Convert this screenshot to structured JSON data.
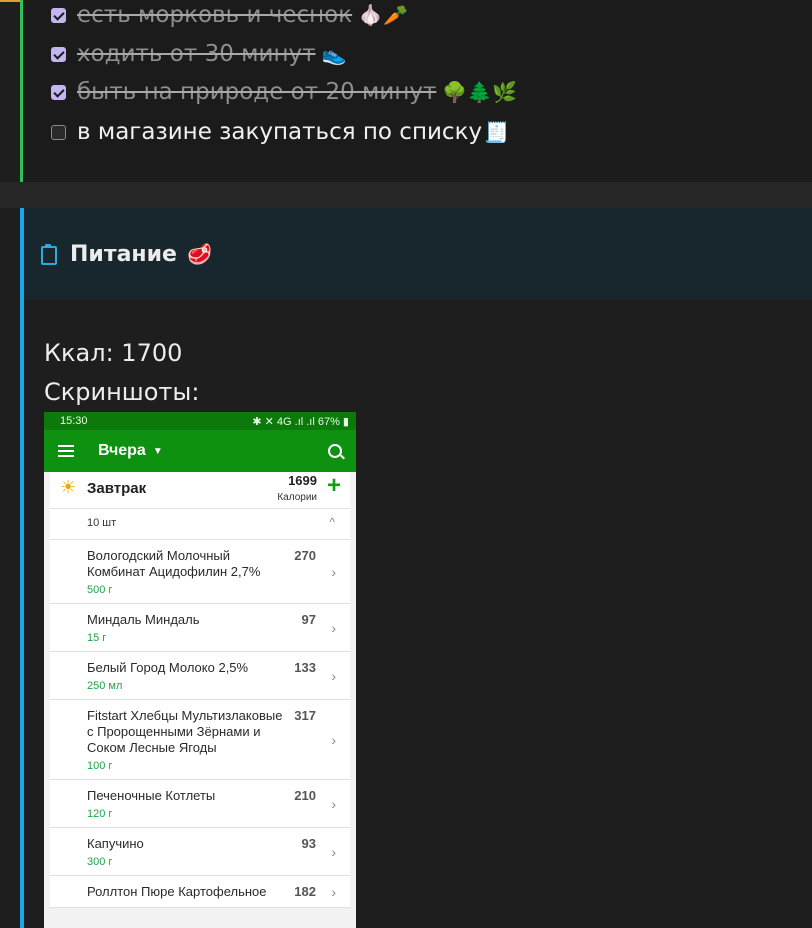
{
  "checklist": [
    {
      "text": "есть морковь и чеснок",
      "emoji": "🧄🥕",
      "checked": true
    },
    {
      "text": "ходить от 30 минут",
      "emoji": "👟",
      "checked": true
    },
    {
      "text": "быть на природе от 20 минут",
      "emoji": "🌳🌲🌿",
      "checked": true
    },
    {
      "text": "в магазине закупаться по списку",
      "emoji": "🧾",
      "checked": false
    }
  ],
  "nutrition": {
    "title": "Питание",
    "title_emoji": "🥩",
    "kcal_line": "Ккал: 1700",
    "screenshots_label": "Скриншоты:"
  },
  "phone": {
    "status_time": "15:30",
    "status_right": "✱ ✕ 4G .ıl .ıl 67% ▮",
    "day_selector": "Вчера",
    "meal": {
      "name": "Завтрак",
      "calories": "1699",
      "calories_label": "Калории"
    },
    "items_count": "10 шт",
    "items": [
      {
        "name": "Вологодский Молочный Комбинат Ацидофилин 2,7%",
        "portion": "500 г",
        "kcal": "270"
      },
      {
        "name": "Миндаль Миндаль",
        "portion": "15 г",
        "kcal": "97"
      },
      {
        "name": "Белый Город Молоко 2,5%",
        "portion": "250 мл",
        "kcal": "133"
      },
      {
        "name": "Fitstart Хлебцы Мультизлаковые с Пророщенными Зёрнами и Соком Лесные Ягоды",
        "portion": "100 г",
        "kcal": "317"
      },
      {
        "name": "Печеночные Котлеты",
        "portion": "120 г",
        "kcal": "210"
      },
      {
        "name": "Капучино",
        "portion": "300 г",
        "kcal": "93"
      },
      {
        "name": "Роллтон Пюре Картофельное",
        "portion": "",
        "kcal": "182"
      }
    ]
  },
  "colors": {
    "checked_box": "#c4b5f0",
    "green_border": "#2ec35a",
    "blue_border": "#19a9ea",
    "app_green": "#0e9010"
  }
}
